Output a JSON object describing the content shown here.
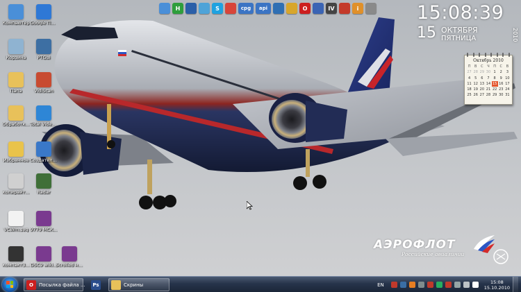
{
  "desktop": {
    "icons": [
      {
        "label": "Компьютер",
        "color": "#4a8fd8",
        "glyph": "computer-icon"
      },
      {
        "label": "Google Планет...",
        "color": "#2e78d6",
        "glyph": "google-earth-icon"
      },
      {
        "label": "Корзина",
        "color": "#8fb3d1",
        "glyph": "recycle-bin-icon"
      },
      {
        "label": "PTGui",
        "color": "#3d6fa3",
        "glyph": "ptgui-icon"
      },
      {
        "label": "Папа",
        "color": "#e8c15a",
        "glyph": "folder-icon"
      },
      {
        "label": "VidiScan",
        "color": "#c84b31",
        "glyph": "vidiscan-icon"
      },
      {
        "label": "Обработк...",
        "color": "#e8c15a",
        "glyph": "folder-icon"
      },
      {
        "label": "Total Video Converter",
        "color": "#2e86d6",
        "glyph": "video-converter-icon"
      },
      {
        "label": "Избранное",
        "color": "#e9c34b",
        "glyph": "star-folder-icon"
      },
      {
        "label": "Создатель Будущего...",
        "color": "#3a78c8",
        "glyph": "shortcut-icon"
      },
      {
        "label": "копирайт...",
        "color": "#d0d0d0",
        "glyph": "file-icon"
      },
      {
        "label": "Radar",
        "color": "#3f6f38",
        "glyph": "radar-icon"
      },
      {
        "label": "VCWm.svg",
        "color": "#f2f2f2",
        "glyph": "svg-file-icon"
      },
      {
        "label": "9779 МСК...",
        "color": "#7a3a8f",
        "glyph": "winrar-icon"
      },
      {
        "label": "компакт3...",
        "color": "#333333",
        "glyph": "calculator-icon"
      },
      {
        "label": "DSC9 wiki...",
        "color": "#7a3a8f",
        "glyph": "winrar-icon"
      },
      {
        "label": "Scrolled на Цветная",
        "color": "#7a3a8f",
        "glyph": "winrar-icon"
      }
    ]
  },
  "topbar": {
    "icons": [
      {
        "name": "computer-mini-icon",
        "color": "#4a8fd8",
        "text": ""
      },
      {
        "name": "utorrent-mini-icon",
        "color": "#2e9e3b",
        "text": "H"
      },
      {
        "name": "document-mini-icon",
        "color": "#2b5fa8",
        "text": ""
      },
      {
        "name": "folder-mini-icon",
        "color": "#4ea3d8",
        "text": ""
      },
      {
        "name": "skype-mini-icon",
        "color": "#1fa2e0",
        "text": "S"
      },
      {
        "name": "chrome-mini-icon",
        "color": "#d8453a",
        "text": ""
      },
      {
        "name": "app-cpg-mini-icon",
        "color": "#3b74c4",
        "text": "cpg"
      },
      {
        "name": "app-api-mini-icon",
        "color": "#3b74c4",
        "text": "api"
      },
      {
        "name": "globe-mini-icon",
        "color": "#2f6fb3",
        "text": ""
      },
      {
        "name": "headphones-mini-icon",
        "color": "#d8a62b",
        "text": ""
      },
      {
        "name": "opera-mini-icon",
        "color": "#cc1f1f",
        "text": "O"
      },
      {
        "name": "plane-mini-icon",
        "color": "#3a64b4",
        "text": ""
      },
      {
        "name": "iv-mini-icon",
        "color": "#444444",
        "text": "IV"
      },
      {
        "name": "tools-mini-icon",
        "color": "#c43a2a",
        "text": ""
      },
      {
        "name": "info-mini-icon",
        "color": "#e0902a",
        "text": "i"
      },
      {
        "name": "wand-mini-icon",
        "color": "#8a8a8a",
        "text": ""
      }
    ]
  },
  "clock": {
    "time": "15:08:39",
    "day": "15",
    "month": "ОКТЯБРЯ",
    "weekday": "ПЯТНИЦА",
    "year": "2010"
  },
  "calendar": {
    "title": "Октябрь 2010",
    "headers": [
      "П",
      "В",
      "С",
      "Ч",
      "П",
      "С",
      "В"
    ],
    "days": [
      "27",
      "28",
      "29",
      "30",
      "1",
      "2",
      "3",
      "4",
      "5",
      "6",
      "7",
      "8",
      "9",
      "10",
      "11",
      "12",
      "13",
      "14",
      "15",
      "16",
      "17",
      "18",
      "19",
      "20",
      "21",
      "22",
      "23",
      "24",
      "25",
      "26",
      "27",
      "28",
      "29",
      "30",
      "31"
    ],
    "today_index": 18,
    "leading_out": 4
  },
  "branding": {
    "name": "АЭРОФЛОТ",
    "subtitle": "Российские авиалинии"
  },
  "taskbar": {
    "buttons": [
      {
        "label": "Посылка файла ...",
        "icon_color": "#cc1f1f",
        "icon_text": "O"
      },
      {
        "label": "",
        "icon_color": "#2a4d8c",
        "icon_text": "Ps"
      },
      {
        "label": "Скрины",
        "icon_color": "#e8c15a",
        "icon_text": ""
      }
    ],
    "language": "EN",
    "tray_colors": [
      "#c0392b",
      "#3a6ea5",
      "#e67e22",
      "#7f8c8d",
      "#c0392b",
      "#27ae60",
      "#c0392b",
      "#95a5a6",
      "#bdc3c7",
      "#ffffff"
    ],
    "time": "15:08",
    "date": "15.10.2010"
  }
}
